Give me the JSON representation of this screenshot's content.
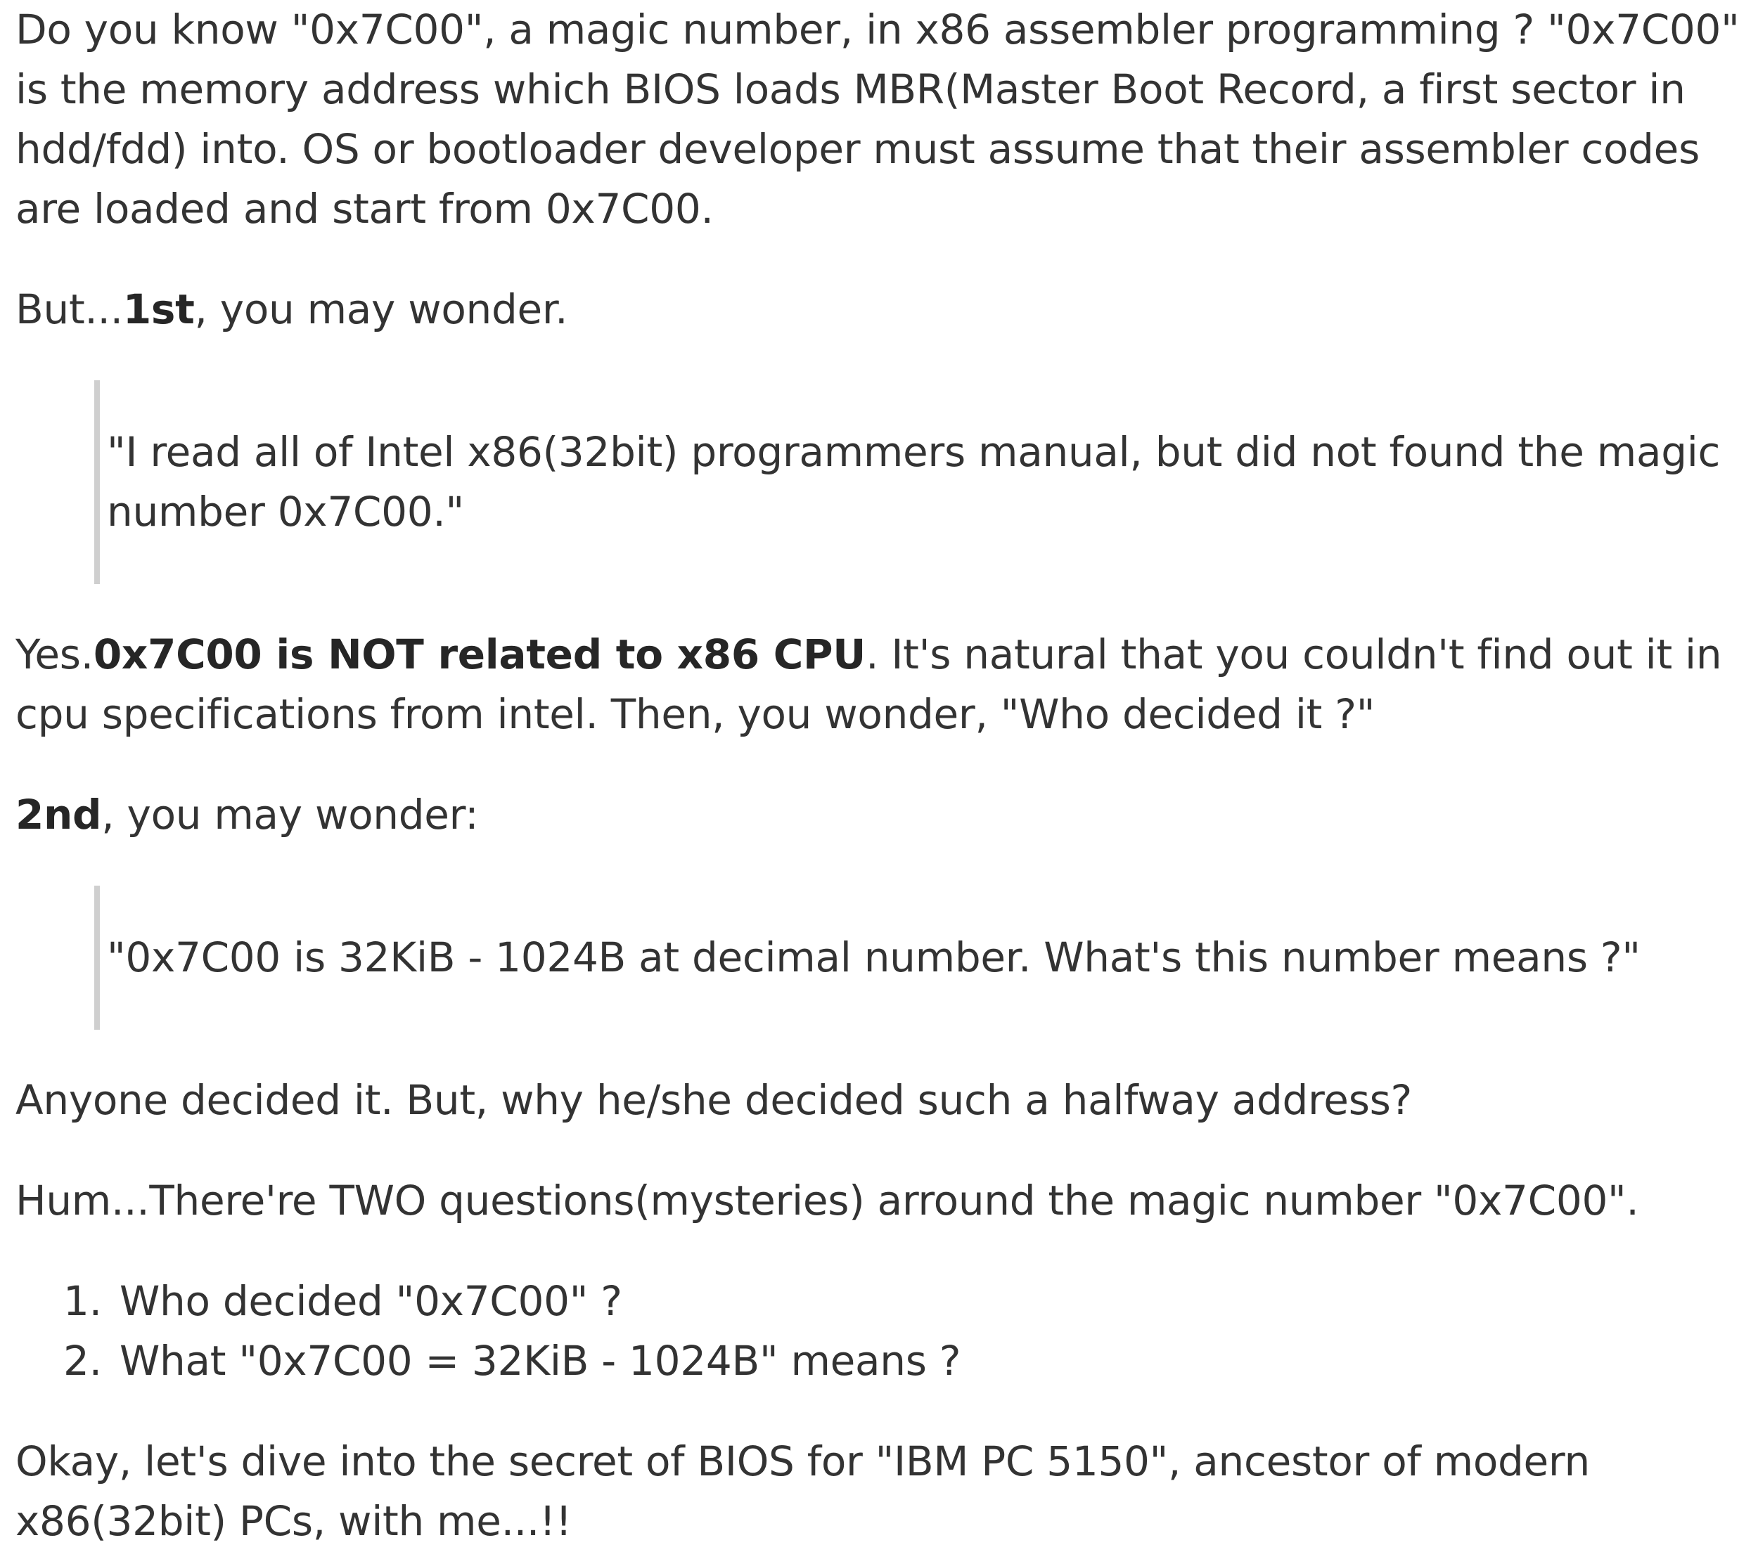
{
  "intro": {
    "text": "Do you know \"0x7C00\", a magic number, in x86 assembler programming ? \"0x7C00\" is the memory address which BIOS loads MBR(Master Boot Record, a first sector in hdd/fdd) into. OS or bootloader developer must assume that their assembler codes are loaded and start from 0x7C00."
  },
  "first": {
    "prefix": "But...",
    "bold": "1st",
    "suffix": ", you may wonder."
  },
  "quote1": {
    "text": "\"I read all of Intel x86(32bit) programmers manual, but did not found the magic number 0x7C00.\""
  },
  "answer": {
    "prefix": "Yes.",
    "bold": "0x7C00 is NOT related to x86 CPU",
    "suffix": ". It's natural that you couldn't find out it in cpu specifications from intel. Then, you wonder, \"Who decided it ?\""
  },
  "second": {
    "bold": "2nd",
    "suffix": ", you may wonder:"
  },
  "quote2": {
    "text": "\"0x7C00 is 32KiB - 1024B at decimal number. What's this number means ?\""
  },
  "halfway": {
    "text": "Anyone decided it. But, why he/she decided such a halfway address?"
  },
  "mysteries": {
    "text": "Hum...There're TWO questions(mysteries) arround the magic number \"0x7C00\"."
  },
  "questions": [
    {
      "num": "1.",
      "text": "Who decided \"0x7C00\" ?"
    },
    {
      "num": "2.",
      "text": "What \"0x7C00 = 32KiB - 1024B\" means ?"
    }
  ],
  "outro": {
    "text": "Okay, let's dive into the secret of BIOS for \"IBM PC 5150\", ancestor of modern x86(32bit) PCs, with me...!!"
  }
}
